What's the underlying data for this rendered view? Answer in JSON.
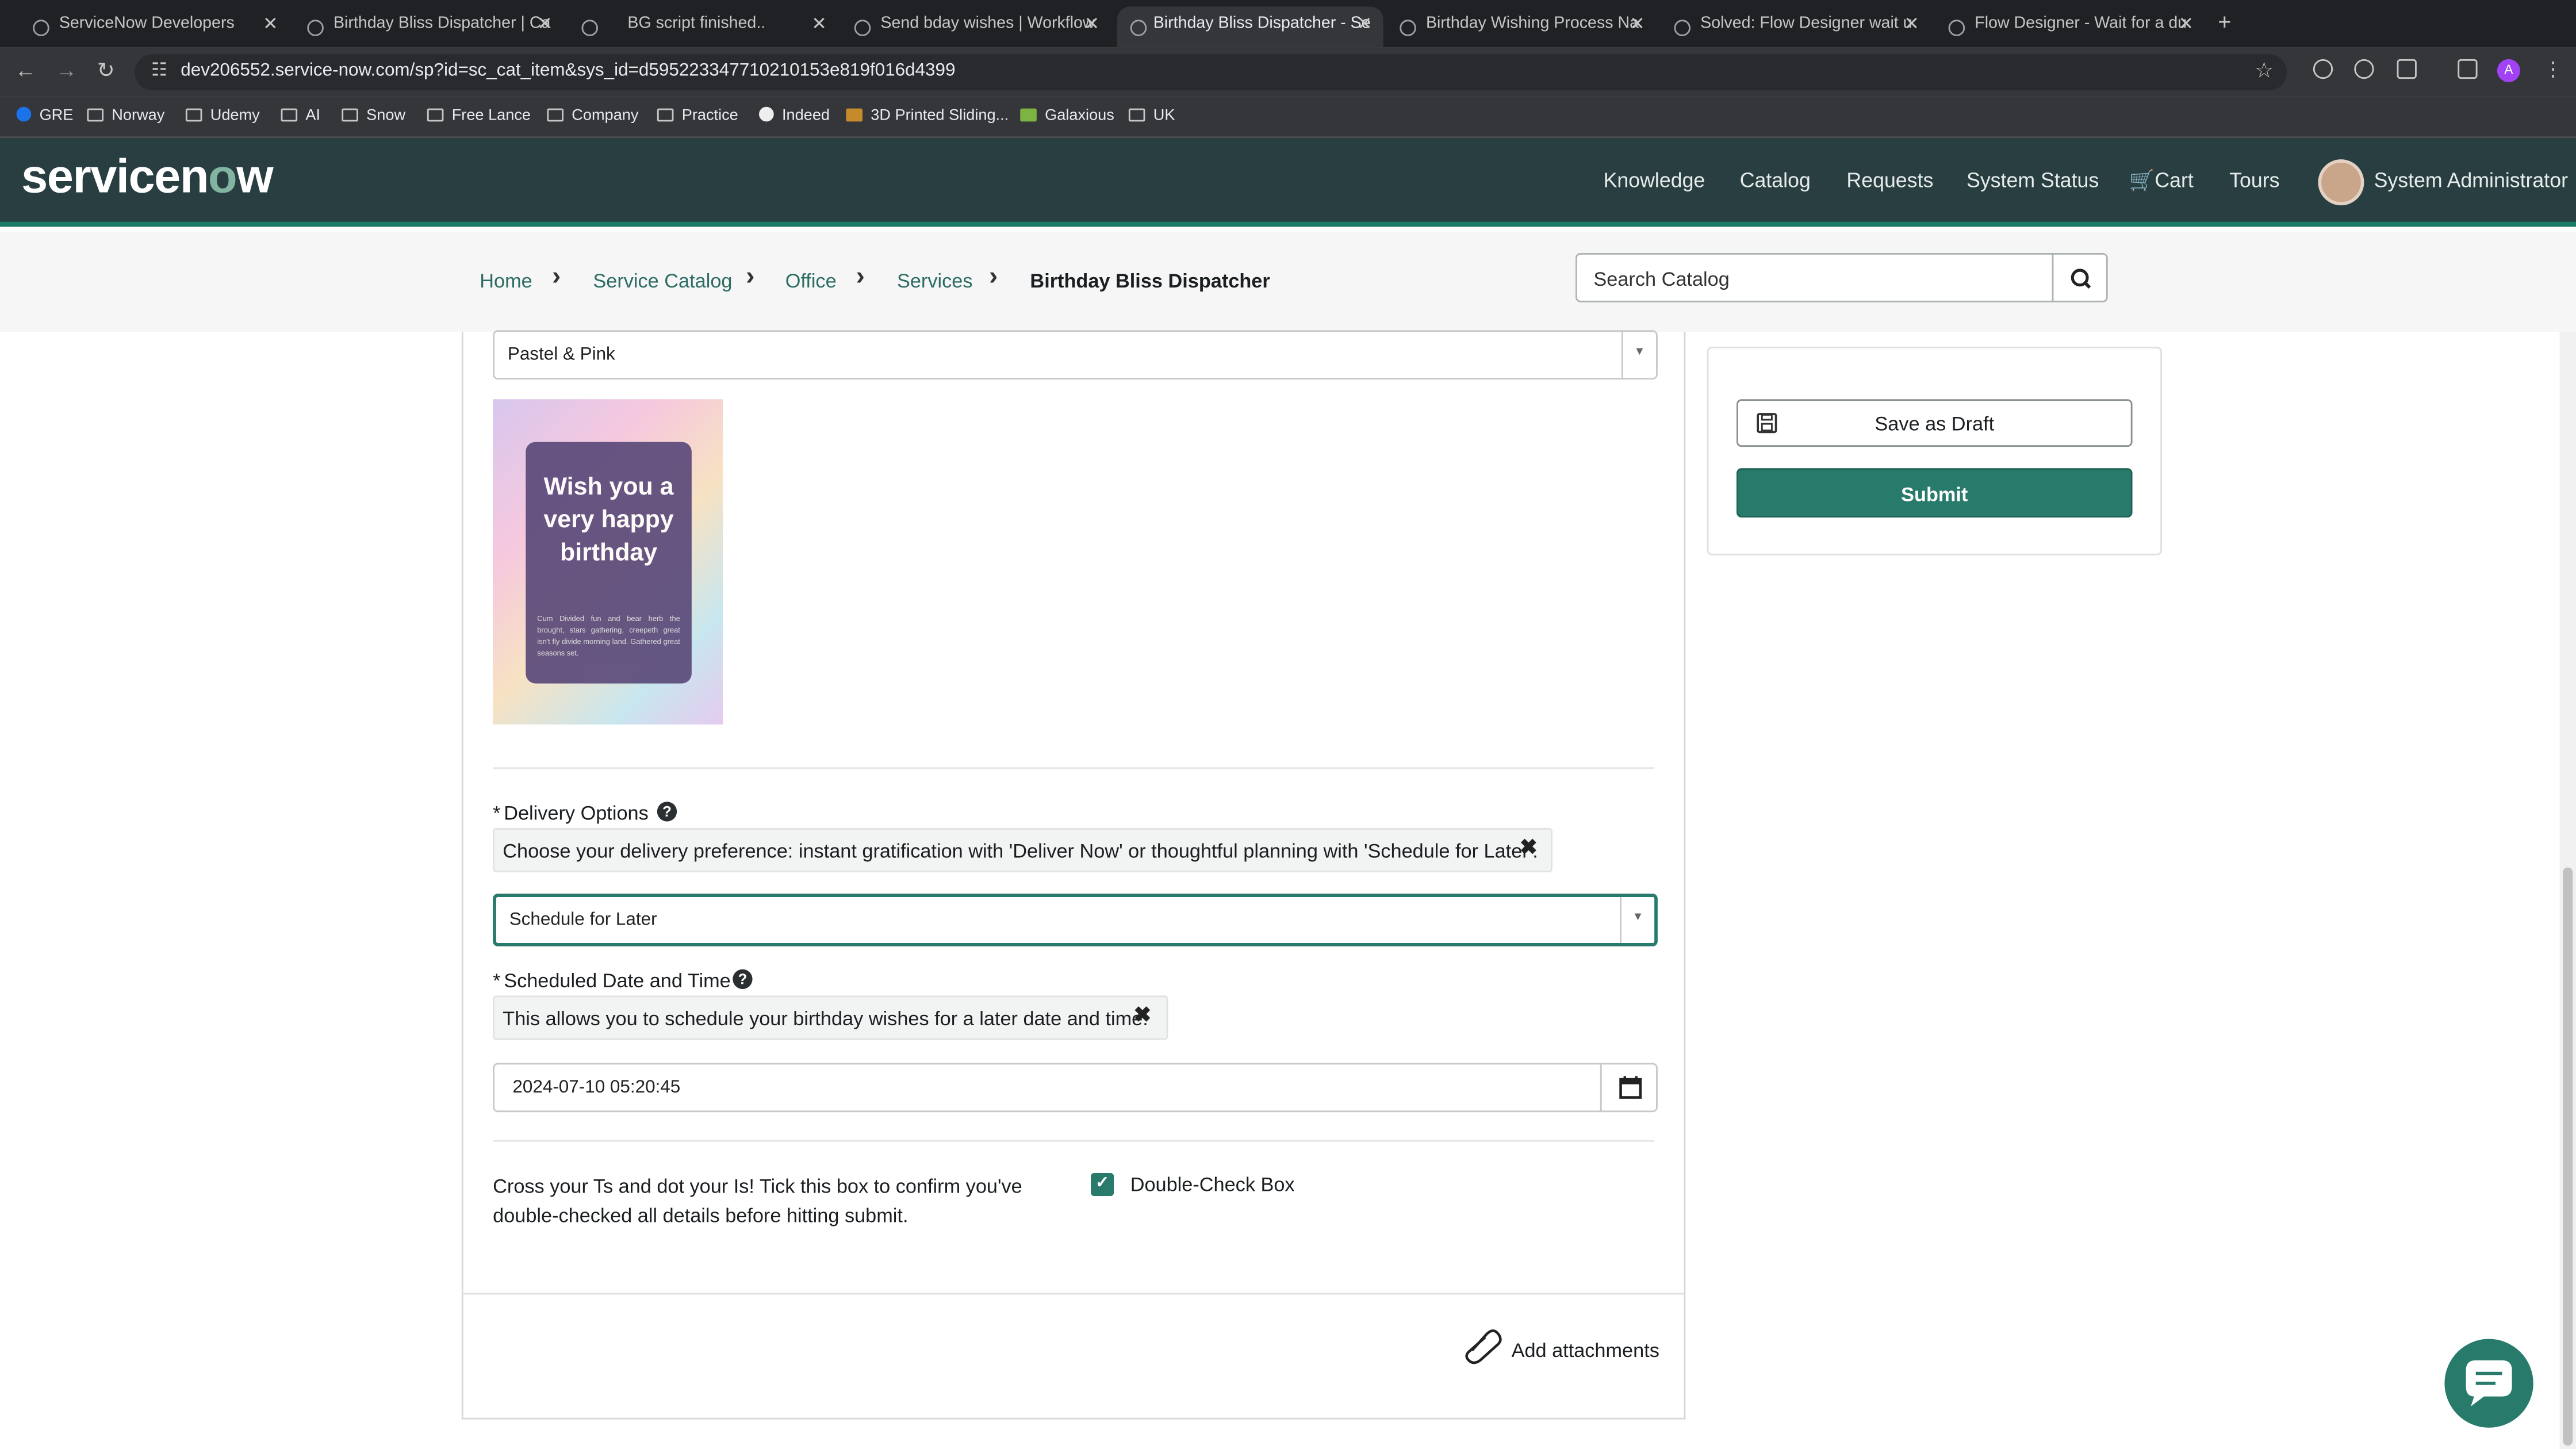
{
  "browser": {
    "tabs": [
      {
        "title": "ServiceNow Developers"
      },
      {
        "title": "Birthday Bliss Dispatcher | Ca"
      },
      {
        "title": "BG script finished.."
      },
      {
        "title": "Send bday wishes | Workflow"
      },
      {
        "title": "Birthday Bliss Dispatcher - Se"
      },
      {
        "title": "Birthday Wishing Process Na"
      },
      {
        "title": "Solved: Flow Designer wait u"
      },
      {
        "title": "Flow Designer - Wait for a du"
      }
    ],
    "active_tab": 4,
    "url": "dev206552.service-now.com/sp?id=sc_cat_item&sys_id=d595223347710210153e819f016d4399",
    "profile_initial": "A",
    "bookmarks": [
      "GRE",
      "Norway",
      "Udemy",
      "AI",
      "Snow",
      "Free Lance",
      "Company",
      "Practice",
      "Indeed",
      "3D Printed Sliding...",
      "Galaxious",
      "UK"
    ]
  },
  "header": {
    "logo_text_a": "servicen",
    "logo_text_o": "o",
    "logo_text_b": "w",
    "nav": [
      "Knowledge",
      "Catalog",
      "Requests",
      "System Status",
      "Cart",
      "Tours"
    ],
    "user_name": "System Administrator",
    "brand_color": "#293e40",
    "accent_color": "#287a6b"
  },
  "breadcrumb": [
    "Home",
    "Service Catalog",
    "Office",
    "Services",
    "Birthday Bliss Dispatcher"
  ],
  "search": {
    "placeholder": "Search Catalog"
  },
  "form": {
    "theme_value": "Pastel & Pink",
    "card_text": "Wish you a very happy birthday",
    "card_fine": "Cum Divided fun and bear herb the brought, stars gathering, creepeth great isn't fly divide morning land. Gathered great seasons set.",
    "delivery": {
      "label": "Delivery Options",
      "hint": "Choose your delivery preference: instant gratification with 'Deliver Now' or thoughtful planning with 'Schedule for Later'.",
      "value": "Schedule for Later"
    },
    "schedule": {
      "label": "Scheduled Date and Time",
      "hint": "This allows you to schedule your birthday wishes for a later date and time.",
      "value": "2024-07-10 05:20:45"
    },
    "confirm_text": "Cross your Ts and dot your Is! Tick this box to confirm you've double-checked all details before hitting submit.",
    "checkbox_label": "Double-Check Box",
    "checkbox_checked": true,
    "attachments_label": "Add attachments"
  },
  "actions": {
    "save_draft": "Save as Draft",
    "submit": "Submit"
  }
}
